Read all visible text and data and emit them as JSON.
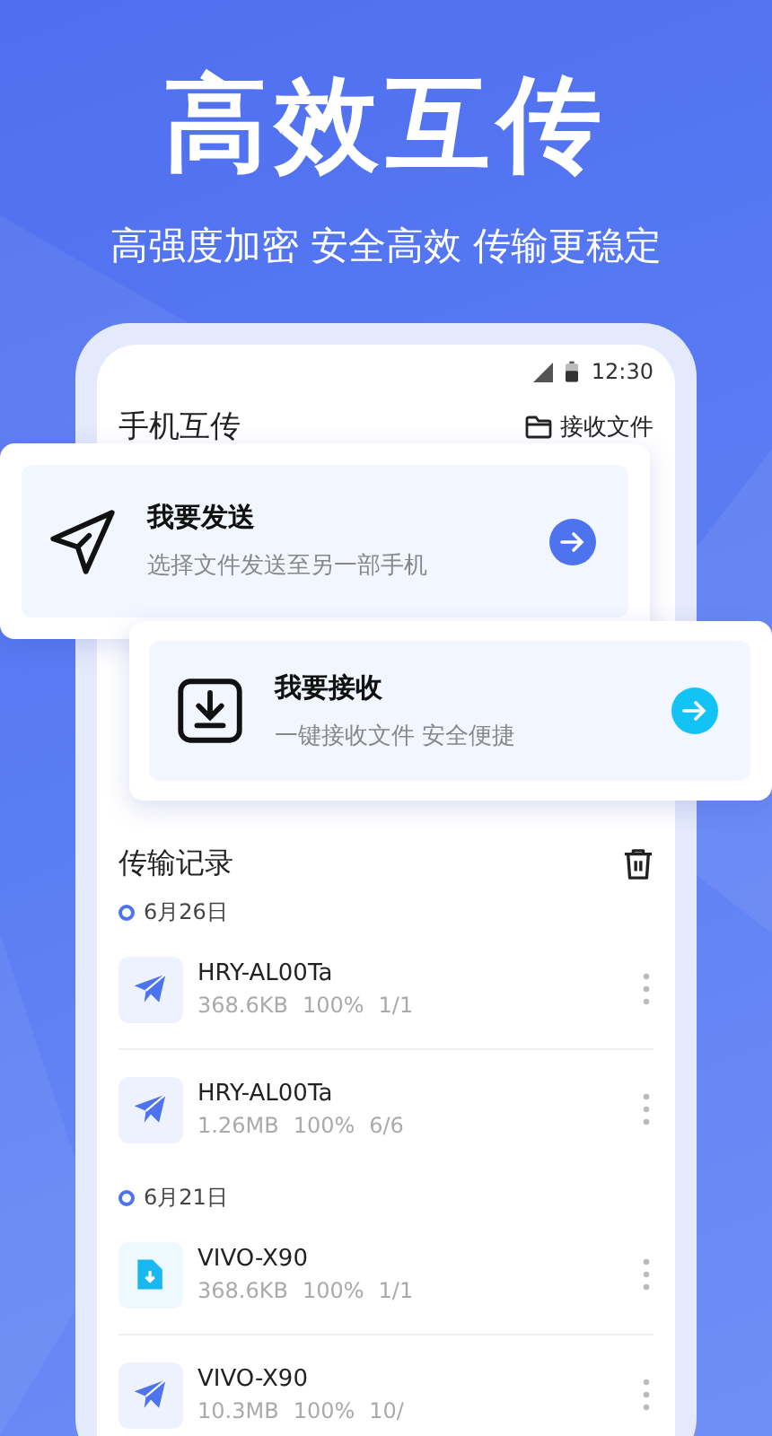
{
  "headline": "高效互传",
  "tagline": "高强度加密 安全高效 传输更稳定",
  "status_bar": {
    "time": "12:30"
  },
  "app_bar": {
    "title": "手机互传",
    "action": "接收文件"
  },
  "actions": [
    {
      "kind": "send",
      "title": "我要发送",
      "subtitle": "选择文件发送至另一部手机"
    },
    {
      "kind": "receive",
      "title": "我要接收",
      "subtitle": "一键接收文件 安全便捷"
    }
  ],
  "history": {
    "title": "传输记录",
    "groups": [
      {
        "date": "6月26日",
        "records": [
          {
            "kind": "send",
            "name": "HRY-AL00Ta",
            "size": "368.6KB",
            "progress": "100%",
            "count": "1/1"
          },
          {
            "kind": "send",
            "name": "HRY-AL00Ta",
            "size": "1.26MB",
            "progress": "100%",
            "count": "6/6"
          }
        ]
      },
      {
        "date": "6月21日",
        "records": [
          {
            "kind": "receive",
            "name": "VIVO-X90",
            "size": "368.6KB",
            "progress": "100%",
            "count": "1/1"
          },
          {
            "kind": "send",
            "name": "VIVO-X90",
            "size": "10.3MB",
            "progress": "100%",
            "count": "10/"
          }
        ]
      }
    ]
  }
}
